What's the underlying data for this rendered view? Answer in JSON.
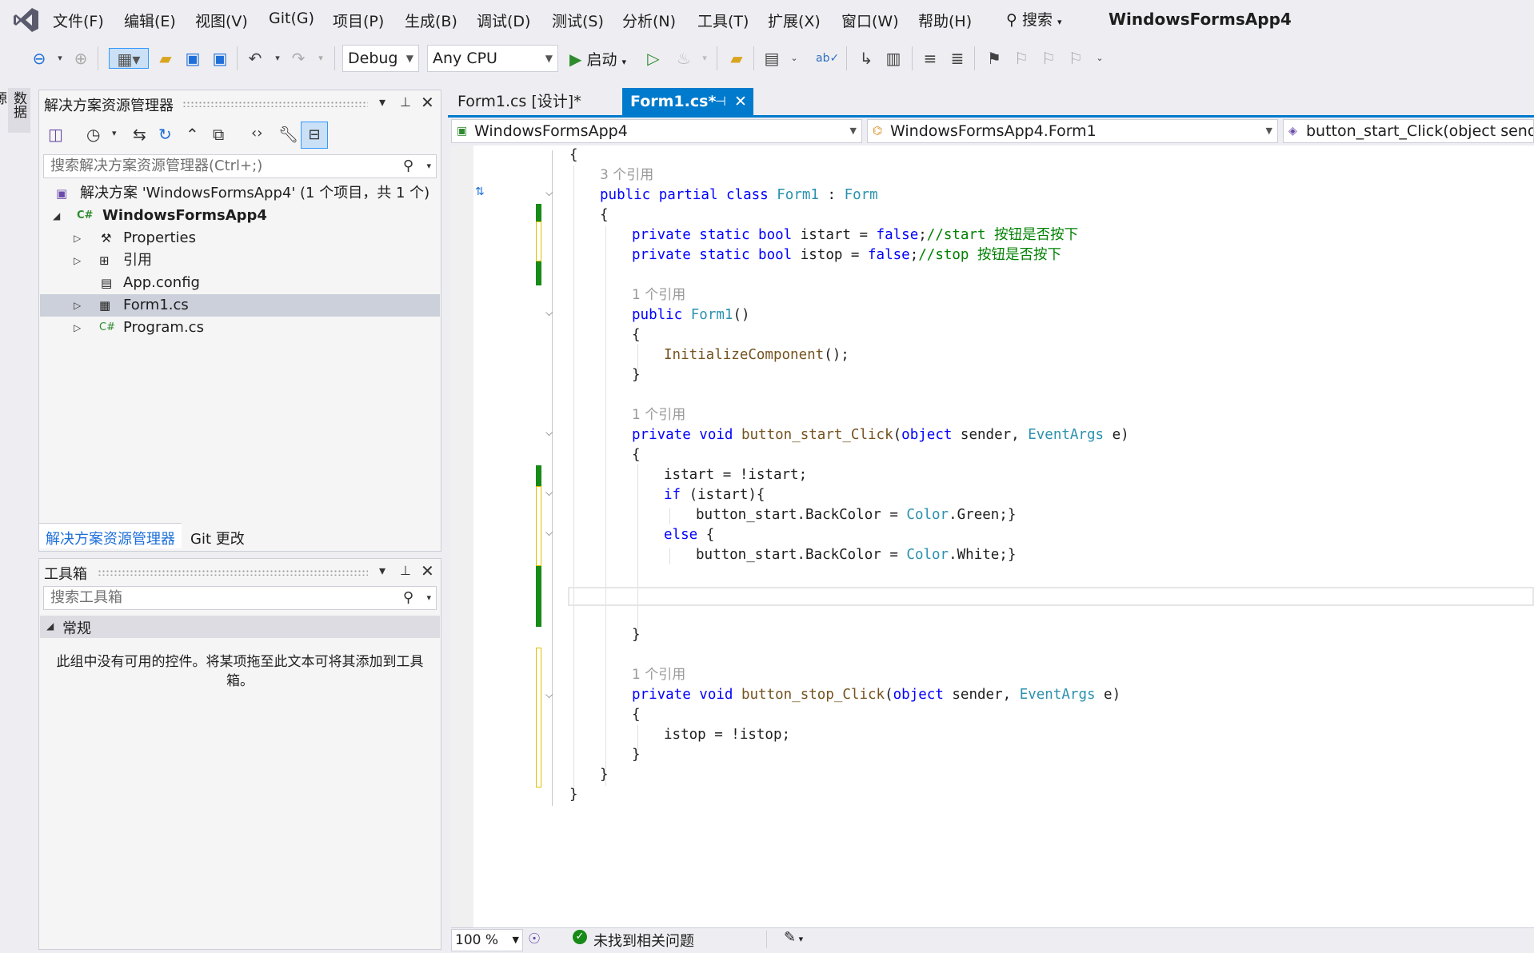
{
  "menu": [
    "文件(F)",
    "编辑(E)",
    "视图(V)",
    "Git(G)",
    "项目(P)",
    "生成(B)",
    "调试(D)",
    "测试(S)",
    "分析(N)",
    "工具(T)",
    "扩展(X)",
    "窗口(W)",
    "帮助(H)"
  ],
  "search_label": "搜索",
  "app_title": "WindowsFormsApp4",
  "toolbar": {
    "config": "Debug",
    "platform": "Any CPU",
    "start_label": "启动"
  },
  "side_tab": "数据源",
  "solution_explorer": {
    "title": "解决方案资源管理器",
    "search_placeholder": "搜索解决方案资源管理器(Ctrl+;)",
    "solution": "解决方案 'WindowsFormsApp4' (1 个项目，共 1 个)",
    "project": "WindowsFormsApp4",
    "items": [
      "Properties",
      "引用",
      "App.config",
      "Form1.cs",
      "Program.cs"
    ],
    "tabs": [
      "解决方案资源管理器",
      "Git 更改"
    ]
  },
  "toolbox": {
    "title": "工具箱",
    "search_placeholder": "搜索工具箱",
    "group": "常规",
    "empty_text": "此组中没有可用的控件。将某项拖至此文本可将其添加到工具箱。"
  },
  "doc_tabs": [
    "Form1.cs [设计]*",
    "Form1.cs*"
  ],
  "nav": {
    "project": "WindowsFormsApp4",
    "class": "WindowsFormsApp4.Form1",
    "member": "button_start_Click(object sender,"
  },
  "refs": {
    "r3": "3 个引用",
    "r1": "1 个引用"
  },
  "status": {
    "zoom": "100 %",
    "issues": "未找到相关问题"
  }
}
